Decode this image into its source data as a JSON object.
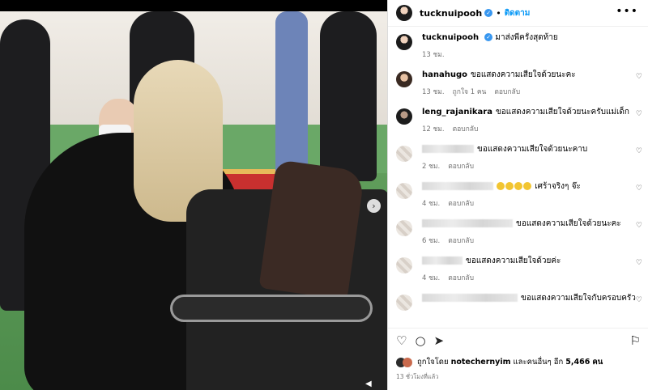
{
  "post": {
    "author": "tucknuipooh",
    "follow_label": "ติดตาม",
    "caption": "มาส่งพี่ครั้งสุดท้าย",
    "caption_time": "13 ชม.",
    "more_icon": "more-horizontal-icon"
  },
  "comments": [
    {
      "user": "hanahugo",
      "text": "ขอแสดงความเสียใจด้วยนะคะ",
      "time": "13 ชม.",
      "likes": "ถูกใจ 1 คน",
      "reply": "ตอบกลับ",
      "blurred": false
    },
    {
      "user": "leng_rajanikara",
      "text": "ขอแสดงความเสียใจด้วยนะครับแม่เด็ก",
      "time": "12 ชม.",
      "likes": "",
      "reply": "ตอบกลับ",
      "blurred": false
    },
    {
      "user": "",
      "text": "ขอแสดงความเสียใจด้วยนะคาบ",
      "time": "2 ชม.",
      "likes": "",
      "reply": "ตอบกลับ",
      "blurred": true
    },
    {
      "user": "",
      "text": "เศร้าจริงๆ จ๊ะ",
      "time": "4 ชม.",
      "likes": "",
      "reply": "ตอบกลับ",
      "blurred": true
    },
    {
      "user": "",
      "text": "ขอแสดงความเสียใจด้วยนะคะ",
      "time": "6 ชม.",
      "likes": "",
      "reply": "ตอบกลับ",
      "blurred": true
    },
    {
      "user": "",
      "text": "ขอแสดงความเสียใจด้วยค่ะ",
      "time": "4 ชม.",
      "likes": "",
      "reply": "ตอบกลับ",
      "blurred": true
    },
    {
      "user": "",
      "text": "ขอแสดงความเสียใจกับครอบครัว",
      "time": "",
      "likes": "",
      "reply": "",
      "blurred": true
    }
  ],
  "footer": {
    "liked_by_prefix": "ถูกใจโดย",
    "liked_by_user": "notechernyim",
    "liked_by_suffix": "และคนอื่นๆ อีก",
    "like_count": "5,466",
    "like_unit": "คน",
    "date": "13 ชั่วโมงที่แล้ว"
  },
  "colors": {
    "accent": "#0095f6",
    "verified": "#3897f0",
    "muted": "#737373"
  }
}
